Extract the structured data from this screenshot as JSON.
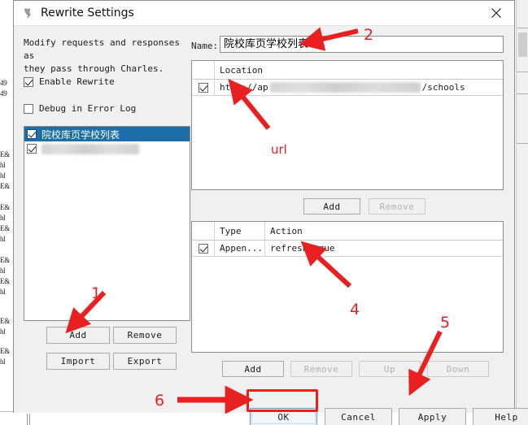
{
  "window": {
    "title": "Rewrite Settings",
    "icon": "charles-app-icon",
    "close_label": "✕"
  },
  "left_panel": {
    "description_line1": "Modify requests and responses as",
    "description_line2": "they pass through Charles.",
    "checkboxes": [
      {
        "label": "Enable Rewrite",
        "checked": true
      },
      {
        "label": "Debug in Error Log",
        "checked": false
      }
    ],
    "rule_list": [
      {
        "label": "院校库页学校列表",
        "checked": true,
        "selected": true,
        "redacted": false
      },
      {
        "label": "",
        "checked": true,
        "selected": false,
        "redacted": true
      }
    ],
    "buttons": [
      {
        "label": "Add",
        "enabled": true
      },
      {
        "label": "Remove",
        "enabled": true
      },
      {
        "label": "Import",
        "enabled": true
      },
      {
        "label": "Export",
        "enabled": true
      }
    ]
  },
  "right_panel": {
    "name_label": "Name:",
    "name_value": "院校库页学校列表",
    "name_placeholder": "",
    "location_table": {
      "columns": [
        "",
        "Location"
      ],
      "rows": [
        {
          "checked": true,
          "location_prefix": "http://ap",
          "location_suffix": "/schools",
          "redacted": true
        }
      ]
    },
    "location_buttons": [
      {
        "label": "Add",
        "enabled": true
      },
      {
        "label": "Remove",
        "enabled": false
      }
    ],
    "rules_table": {
      "columns": [
        "",
        "Type",
        "Action"
      ],
      "rows": [
        {
          "checked": true,
          "type": "Appen...",
          "action": "refresh:true"
        }
      ]
    },
    "rules_buttons": [
      {
        "label": "Add",
        "enabled": true
      },
      {
        "label": "Remove",
        "enabled": false
      },
      {
        "label": "Up",
        "enabled": false
      },
      {
        "label": "Down",
        "enabled": false
      }
    ]
  },
  "footer": {
    "buttons": [
      {
        "label": "OK",
        "enabled": true,
        "focused": true,
        "highlighted": true
      },
      {
        "label": "Cancel",
        "enabled": true,
        "focused": false,
        "highlighted": false
      },
      {
        "label": "Apply",
        "enabled": true,
        "focused": false,
        "highlighted": false
      },
      {
        "label": "Help",
        "enabled": true,
        "focused": false,
        "highlighted": false
      }
    ]
  },
  "annotations": {
    "color": "#e8201f",
    "markers": [
      {
        "id": "1",
        "text": "1"
      },
      {
        "id": "2",
        "text": "2"
      },
      {
        "id": "4",
        "text": "4"
      },
      {
        "id": "5",
        "text": "5"
      },
      {
        "id": "6",
        "text": "6"
      }
    ],
    "labels": [
      {
        "id": "url",
        "text": "url"
      }
    ]
  },
  "background": {
    "fragments": [
      "49",
      "49",
      "E&",
      "hl",
      "hl",
      "E&",
      "E&",
      "hl",
      "E&",
      "hl",
      "E&",
      "hl",
      "E&",
      "hl",
      "E&",
      "hl",
      "E&",
      "hl"
    ]
  }
}
